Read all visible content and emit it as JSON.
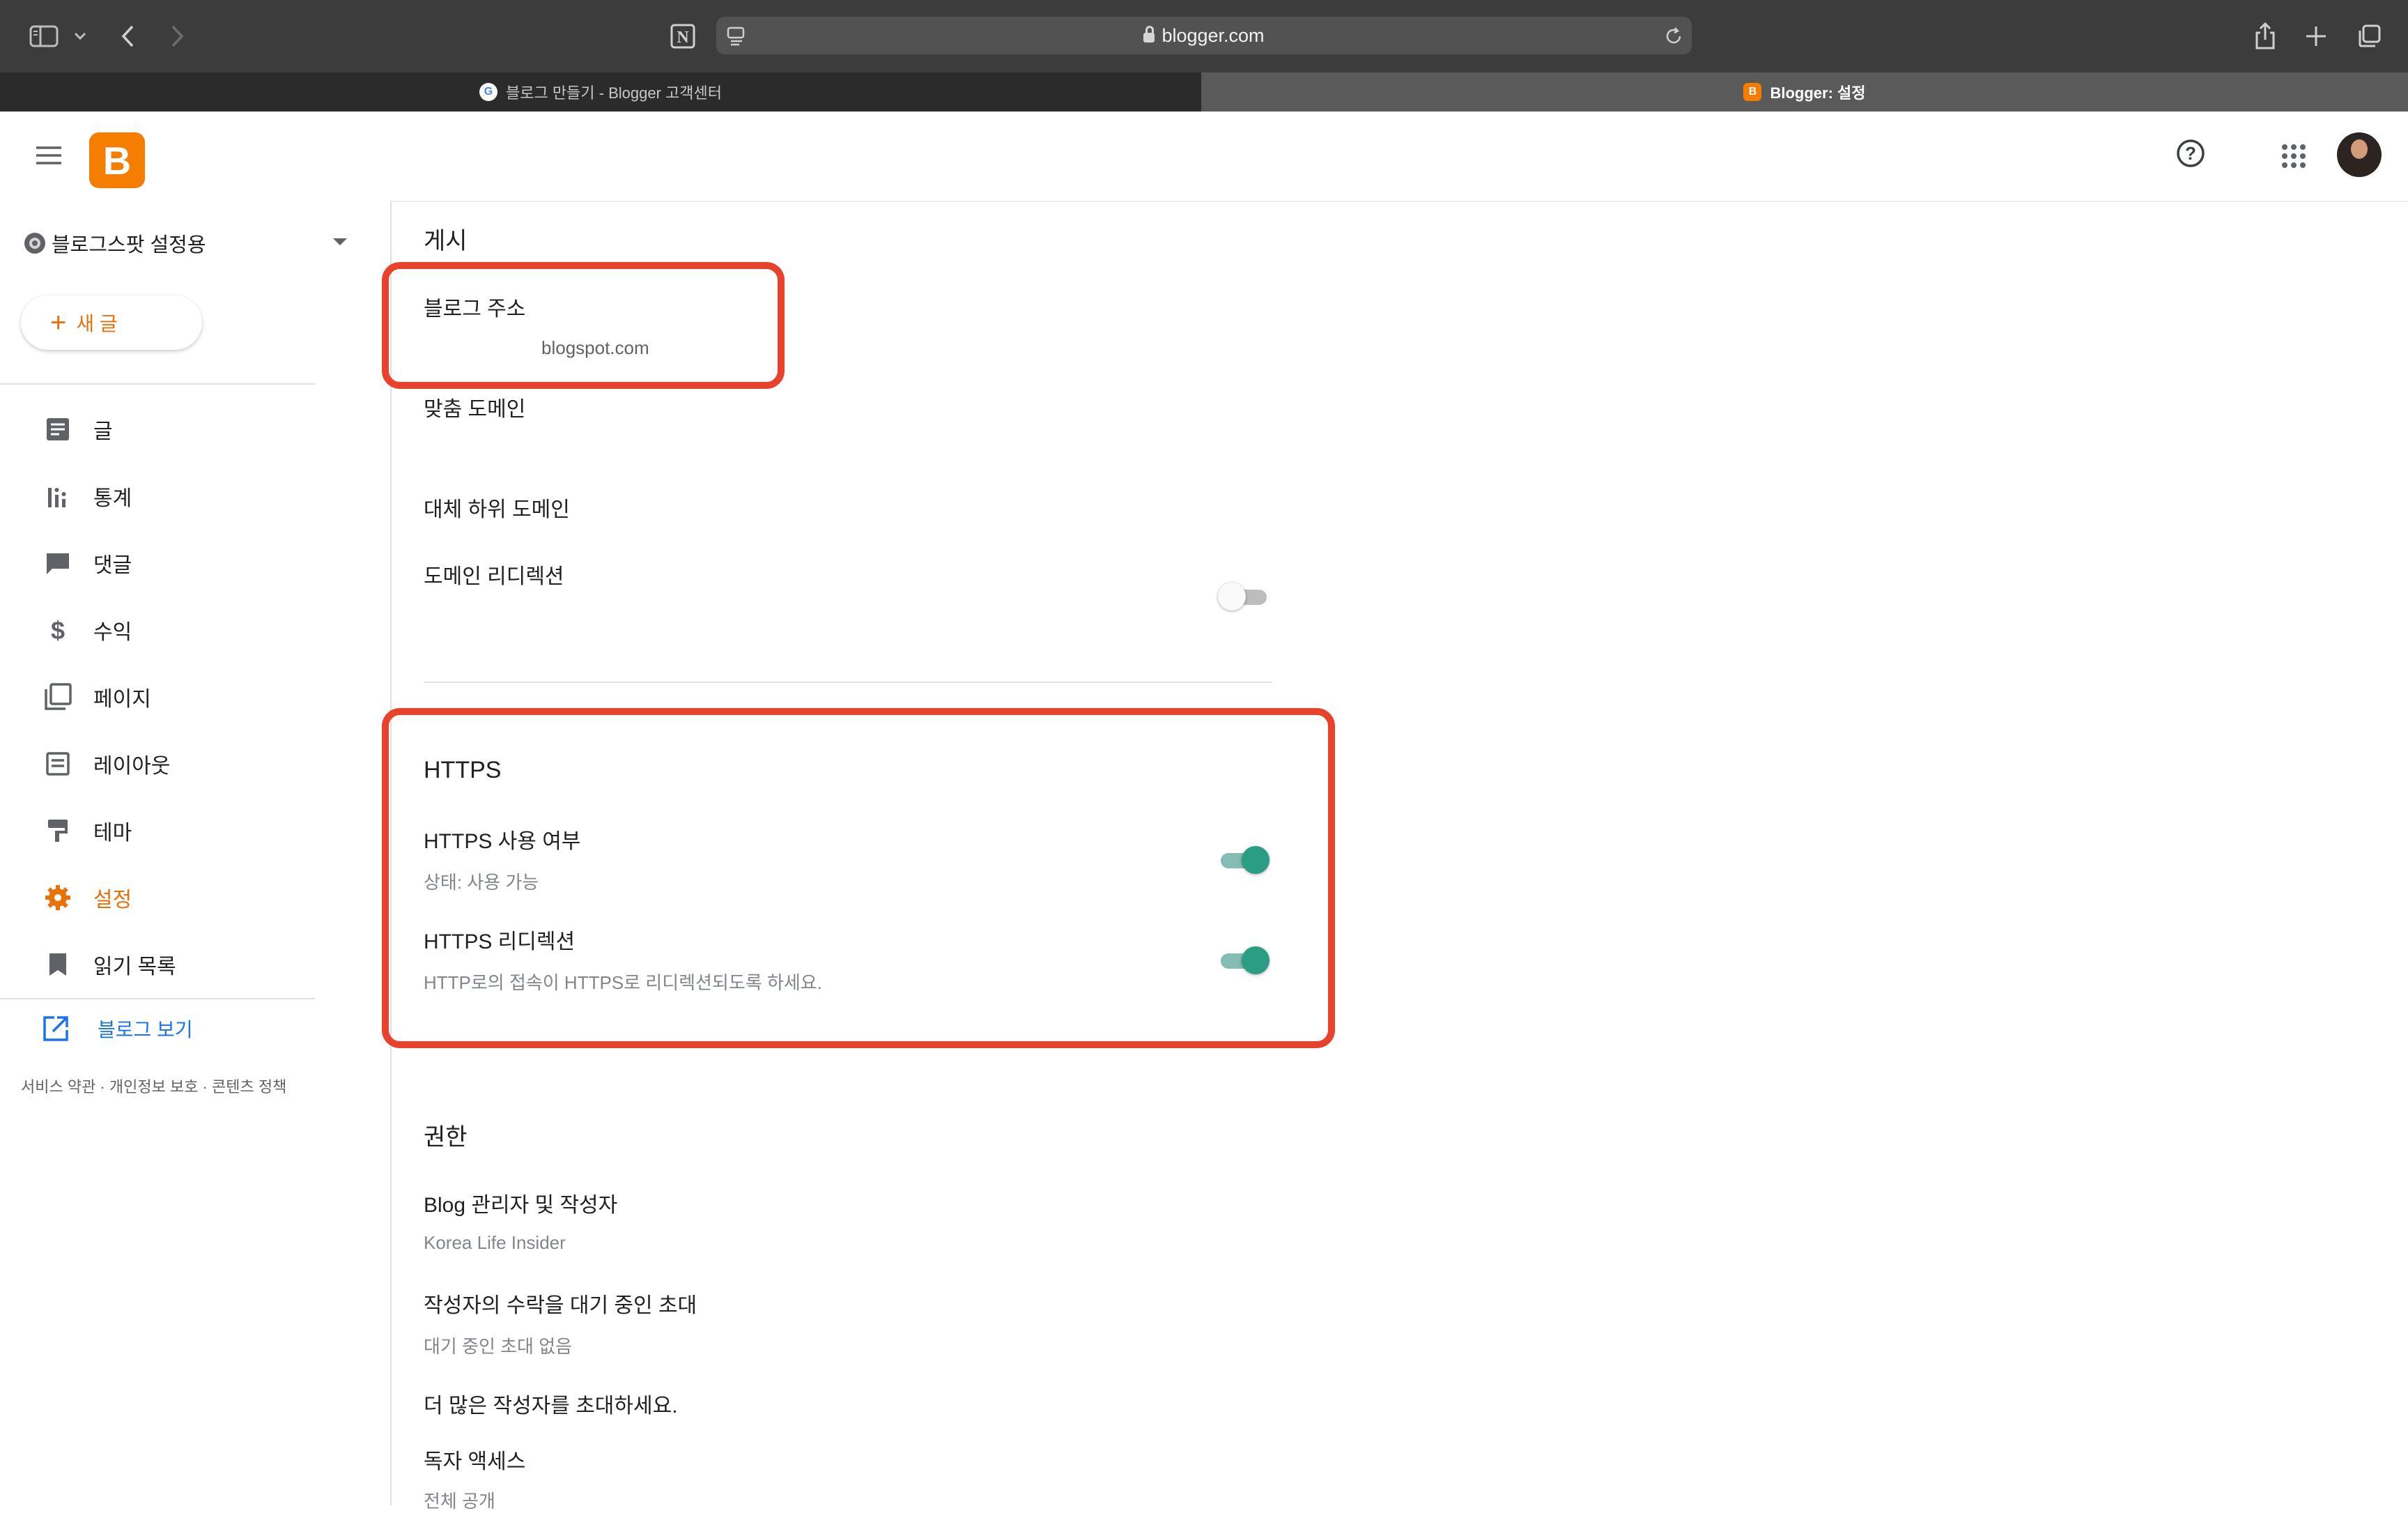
{
  "browser": {
    "url": "blogger.com",
    "tabs": [
      {
        "label": "블로그 만들기 - Blogger 고객센터",
        "favicon": "G"
      },
      {
        "label": "Blogger: 설정",
        "favicon": "B"
      }
    ]
  },
  "app": {
    "logo_letter": "B",
    "help_icon": "?",
    "apps_icon": "apps-grid-icon"
  },
  "sidebar": {
    "blog_name": "블로그스팟 설정용",
    "new_post_label": "새 글",
    "items": [
      {
        "label": "글",
        "icon": "posts-icon"
      },
      {
        "label": "통계",
        "icon": "stats-icon"
      },
      {
        "label": "댓글",
        "icon": "comments-icon"
      },
      {
        "label": "수익",
        "icon": "earnings-icon"
      },
      {
        "label": "페이지",
        "icon": "pages-icon"
      },
      {
        "label": "레이아웃",
        "icon": "layout-icon"
      },
      {
        "label": "테마",
        "icon": "theme-icon"
      },
      {
        "label": "설정",
        "icon": "settings-icon",
        "active": true
      },
      {
        "label": "읽기 목록",
        "icon": "reading-list-icon"
      }
    ],
    "view_blog_label": "블로그 보기",
    "footer_links": [
      "서비스 약관",
      "개인정보 보호",
      "콘텐츠 정책"
    ]
  },
  "main": {
    "publishing": {
      "heading": "게시",
      "blog_address_title": "블로그 주소",
      "blog_address_value": "blogspot.com",
      "custom_domain_title": "맞춤 도메인",
      "fallback_subdomain_title": "대체 하위 도메인",
      "domain_redirect_title": "도메인 리디렉션",
      "domain_redirect_on": false
    },
    "https": {
      "heading": "HTTPS",
      "availability_title": "HTTPS 사용 여부",
      "availability_sub": "상태: 사용 가능",
      "availability_on": true,
      "redirect_title": "HTTPS 리디렉션",
      "redirect_sub": "HTTP로의 접속이 HTTPS로 리디렉션되도록 하세요.",
      "redirect_on": true
    },
    "permissions": {
      "heading": "권한",
      "admins_title": "Blog 관리자 및 작성자",
      "admins_sub": "Korea Life Insider",
      "pending_title": "작성자의 수락을 대기 중인 초대",
      "pending_sub": "대기 중인 초대 없음",
      "invite_more": "더 많은 작성자를 초대하세요.",
      "reader_access_title": "독자 액세스",
      "reader_access_sub": "전체 공개"
    }
  },
  "colors": {
    "accent_orange": "#e8710a",
    "highlight_red": "#e8412c",
    "toggle_teal": "#2a9d82"
  }
}
